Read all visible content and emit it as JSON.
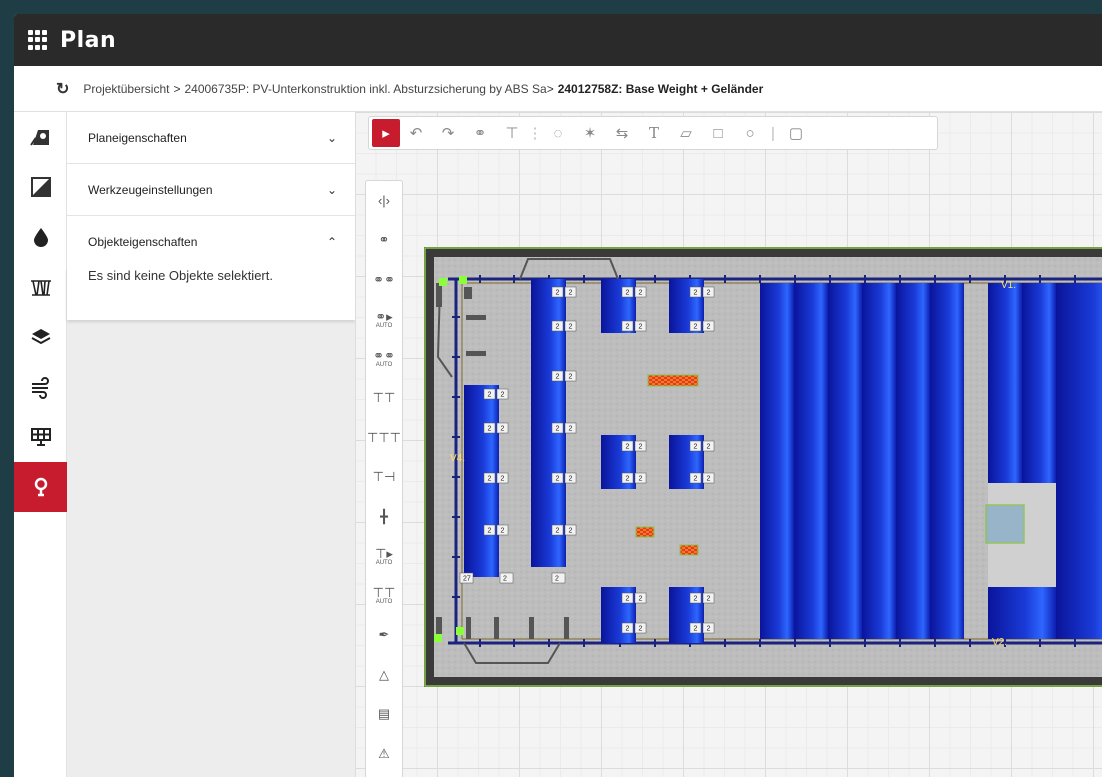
{
  "app": {
    "title": "Plan"
  },
  "breadcrumb": {
    "items": [
      "Projektübersicht",
      "24006735P: PV-Unterkonstruktion inkl. Absturzsicherung by ABS Sa",
      "24012758Z: Base Weight + Geländer"
    ],
    "separator": ">"
  },
  "panel": {
    "sections": [
      {
        "label": "Planeigenschaften",
        "state": "collapsed"
      },
      {
        "label": "Werkzeugeinstellungen",
        "state": "collapsed"
      },
      {
        "label": "Objekteigenschaften",
        "state": "expanded"
      }
    ],
    "empty_message": "Es sind keine Objekte selektiert."
  },
  "left_rail": {
    "items": [
      "map-upload-icon",
      "area-draw-icon",
      "drop-icon",
      "weight-icon",
      "layers-icon",
      "wind-icon",
      "solar-panel-icon",
      "anchor-point-icon"
    ],
    "active_index": 7
  },
  "toolbar": {
    "tools": [
      "select-cursor-icon",
      "undo-icon",
      "redo-icon",
      "paperclip-icon",
      "move-axis-icon",
      "divider",
      "circle-dashed-icon",
      "lasso-icon",
      "measure-icon",
      "text-icon",
      "polygon-icon",
      "rectangle-icon",
      "circle-icon",
      "divider",
      "trash-icon"
    ],
    "text_tool_label": "T"
  },
  "side_tools": {
    "auto_label": "AUTO"
  },
  "plan": {
    "labels": {
      "v1": "V1.",
      "v2": "V2.",
      "v4": "V4."
    },
    "ballast_value": "2",
    "special_value": "27"
  },
  "colors": {
    "accent": "#c61c2d",
    "appbar": "#2a2a2a",
    "roof_border": "#3a3a3a",
    "roof_edge": "#8bc34a",
    "module_dark": "#0a1aa0",
    "module_light": "#3b66ff"
  }
}
